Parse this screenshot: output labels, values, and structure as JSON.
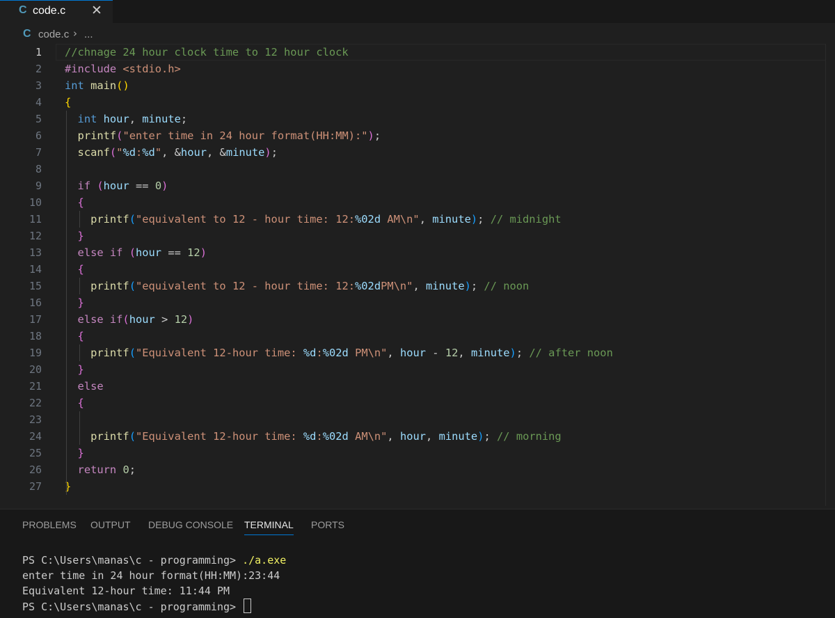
{
  "tab": {
    "icon": "C",
    "filename": "code.c",
    "close_glyph": "✕"
  },
  "breadcrumb": {
    "icon": "C",
    "filename": "code.c",
    "separator": "›",
    "more": "..."
  },
  "editor": {
    "active_line": 1,
    "lines": [
      [
        [
          "comment",
          "//chnage 24 hour clock time to 12 hour clock"
        ]
      ],
      [
        [
          "include",
          "#include "
        ],
        [
          "header",
          "<stdio.h>"
        ]
      ],
      [
        [
          "keyword",
          "int"
        ],
        [
          "plain",
          " "
        ],
        [
          "function",
          "main"
        ],
        [
          "brace1",
          "()"
        ]
      ],
      [
        [
          "brace1",
          "{"
        ]
      ],
      [
        [
          "plain",
          "  "
        ],
        [
          "keyword",
          "int"
        ],
        [
          "plain",
          " "
        ],
        [
          "variable",
          "hour"
        ],
        [
          "plain",
          ", "
        ],
        [
          "variable",
          "minute"
        ],
        [
          "plain",
          ";"
        ]
      ],
      [
        [
          "plain",
          "  "
        ],
        [
          "function",
          "printf"
        ],
        [
          "brace2",
          "("
        ],
        [
          "string",
          "\"enter time in 24 hour format(HH:MM):\""
        ],
        [
          "brace2",
          ")"
        ],
        [
          "plain",
          ";"
        ]
      ],
      [
        [
          "plain",
          "  "
        ],
        [
          "function",
          "scanf"
        ],
        [
          "brace2",
          "("
        ],
        [
          "string",
          "\""
        ],
        [
          "format",
          "%d"
        ],
        [
          "string",
          ":"
        ],
        [
          "format",
          "%d"
        ],
        [
          "string",
          "\""
        ],
        [
          "plain",
          ", &"
        ],
        [
          "variable",
          "hour"
        ],
        [
          "plain",
          ", &"
        ],
        [
          "variable",
          "minute"
        ],
        [
          "brace2",
          ")"
        ],
        [
          "plain",
          ";"
        ]
      ],
      [],
      [
        [
          "plain",
          "  "
        ],
        [
          "control",
          "if"
        ],
        [
          "plain",
          " "
        ],
        [
          "brace2",
          "("
        ],
        [
          "variable",
          "hour"
        ],
        [
          "plain",
          " == "
        ],
        [
          "number",
          "0"
        ],
        [
          "brace2",
          ")"
        ]
      ],
      [
        [
          "plain",
          "  "
        ],
        [
          "brace2",
          "{"
        ]
      ],
      [
        [
          "plain",
          "    "
        ],
        [
          "function",
          "printf"
        ],
        [
          "brace3",
          "("
        ],
        [
          "string",
          "\"equivalent to 12 - hour time: 12:"
        ],
        [
          "format",
          "%02d"
        ],
        [
          "string",
          " AM\\n\""
        ],
        [
          "plain",
          ", "
        ],
        [
          "variable",
          "minute"
        ],
        [
          "brace3",
          ")"
        ],
        [
          "plain",
          "; "
        ],
        [
          "comment",
          "// midnight"
        ]
      ],
      [
        [
          "plain",
          "  "
        ],
        [
          "brace2",
          "}"
        ]
      ],
      [
        [
          "plain",
          "  "
        ],
        [
          "control",
          "else if"
        ],
        [
          "plain",
          " "
        ],
        [
          "brace2",
          "("
        ],
        [
          "variable",
          "hour"
        ],
        [
          "plain",
          " == "
        ],
        [
          "number",
          "12"
        ],
        [
          "brace2",
          ")"
        ]
      ],
      [
        [
          "plain",
          "  "
        ],
        [
          "brace2",
          "{"
        ]
      ],
      [
        [
          "plain",
          "    "
        ],
        [
          "function",
          "printf"
        ],
        [
          "brace3",
          "("
        ],
        [
          "string",
          "\"equivalent to 12 - hour time: 12:"
        ],
        [
          "format",
          "%02d"
        ],
        [
          "string",
          "PM\\n\""
        ],
        [
          "plain",
          ", "
        ],
        [
          "variable",
          "minute"
        ],
        [
          "brace3",
          ")"
        ],
        [
          "plain",
          "; "
        ],
        [
          "comment",
          "// noon"
        ]
      ],
      [
        [
          "plain",
          "  "
        ],
        [
          "brace2",
          "}"
        ]
      ],
      [
        [
          "plain",
          "  "
        ],
        [
          "control",
          "else if"
        ],
        [
          "brace2",
          "("
        ],
        [
          "variable",
          "hour"
        ],
        [
          "plain",
          " > "
        ],
        [
          "number",
          "12"
        ],
        [
          "brace2",
          ")"
        ]
      ],
      [
        [
          "plain",
          "  "
        ],
        [
          "brace2",
          "{"
        ]
      ],
      [
        [
          "plain",
          "    "
        ],
        [
          "function",
          "printf"
        ],
        [
          "brace3",
          "("
        ],
        [
          "string",
          "\"Equivalent 12-hour time: "
        ],
        [
          "format",
          "%d"
        ],
        [
          "string",
          ":"
        ],
        [
          "format",
          "%02d"
        ],
        [
          "string",
          " PM\\n\""
        ],
        [
          "plain",
          ", "
        ],
        [
          "variable",
          "hour"
        ],
        [
          "plain",
          " - "
        ],
        [
          "number",
          "12"
        ],
        [
          "plain",
          ", "
        ],
        [
          "variable",
          "minute"
        ],
        [
          "brace3",
          ")"
        ],
        [
          "plain",
          "; "
        ],
        [
          "comment",
          "// after noon"
        ]
      ],
      [
        [
          "plain",
          "  "
        ],
        [
          "brace2",
          "}"
        ]
      ],
      [
        [
          "plain",
          "  "
        ],
        [
          "control",
          "else"
        ]
      ],
      [
        [
          "plain",
          "  "
        ],
        [
          "brace2",
          "{"
        ]
      ],
      [],
      [
        [
          "plain",
          "    "
        ],
        [
          "function",
          "printf"
        ],
        [
          "brace3",
          "("
        ],
        [
          "string",
          "\"Equivalent 12-hour time: "
        ],
        [
          "format",
          "%d"
        ],
        [
          "string",
          ":"
        ],
        [
          "format",
          "%02d"
        ],
        [
          "string",
          " AM\\n\""
        ],
        [
          "plain",
          ", "
        ],
        [
          "variable",
          "hour"
        ],
        [
          "plain",
          ", "
        ],
        [
          "variable",
          "minute"
        ],
        [
          "brace3",
          ")"
        ],
        [
          "plain",
          "; "
        ],
        [
          "comment",
          "// morning"
        ]
      ],
      [
        [
          "plain",
          "  "
        ],
        [
          "brace2",
          "}"
        ]
      ],
      [
        [
          "plain",
          "  "
        ],
        [
          "control",
          "return"
        ],
        [
          "plain",
          " "
        ],
        [
          "number",
          "0"
        ],
        [
          "plain",
          ";"
        ]
      ],
      [
        [
          "brace1",
          "}"
        ]
      ]
    ]
  },
  "panel": {
    "tabs": [
      "PROBLEMS",
      "OUTPUT",
      "DEBUG CONSOLE",
      "TERMINAL",
      "PORTS"
    ],
    "active_tab": "TERMINAL"
  },
  "terminal": {
    "prompt": "PS C:\\Users\\manas\\c - programming> ",
    "command": "./a.exe",
    "output": [
      "enter time in 24 hour format(HH:MM):23:44",
      "Equivalent 12-hour time: 11:44 PM"
    ]
  }
}
